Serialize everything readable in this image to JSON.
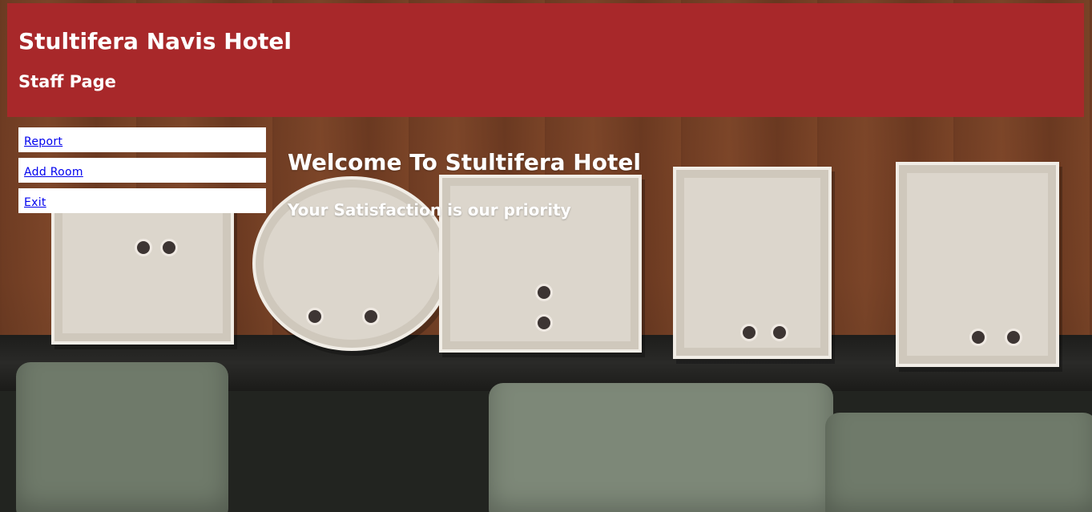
{
  "header": {
    "title": "Stultifera Navis Hotel",
    "subtitle": "Staff Page"
  },
  "nav": {
    "items": [
      {
        "label": "Report"
      },
      {
        "label": "Add Room"
      },
      {
        "label": "Exit"
      }
    ]
  },
  "main": {
    "welcome_title": "Welcome To Stultifera Hotel",
    "welcome_subtitle": "Your Satisfaction is our priority"
  },
  "colors": {
    "header_bg": "#a8282a",
    "link": "#0000ee",
    "text_on_dark": "#ffffff"
  },
  "background": {
    "depicts": "HOTEL"
  }
}
